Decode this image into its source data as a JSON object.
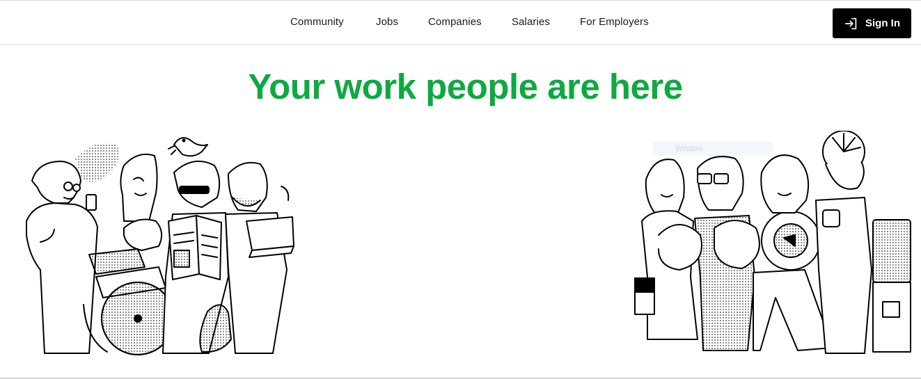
{
  "nav": {
    "links": [
      "Community",
      "Jobs",
      "Companies",
      "Salaries",
      "For Employers"
    ],
    "sign_in_label": "Sign In"
  },
  "hero": {
    "title": "Your work people are here"
  },
  "overlay": {
    "watermark_text": "Window"
  },
  "icons": {
    "sign_in": "sign-in-arrow-icon"
  },
  "colors": {
    "accent_green": "#0caa41",
    "button_bg": "#000000"
  }
}
